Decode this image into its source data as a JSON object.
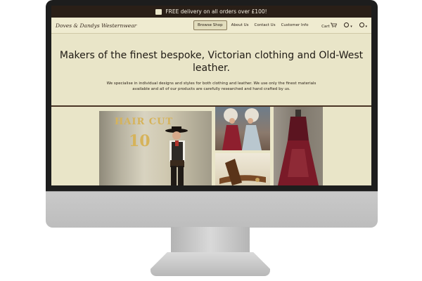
{
  "promo": {
    "text": "FREE delivery on all orders over £100!",
    "icon": "gift-icon"
  },
  "nav": {
    "logo": "Doves & Dandys Westernwear",
    "links": [
      "Browse Shop",
      "About Us",
      "Contact Us",
      "Customer Info"
    ],
    "cart_label": "Cart",
    "icons": [
      "cart-icon",
      "currency-icon",
      "account-icon"
    ]
  },
  "hero": {
    "title": "Makers of the finest bespoke, Victorian clothing and Old-West leather.",
    "body": "We specialise in individual designs and styles for both clothing and leather. We use only the finest materials available and all of our products are carefully researched and hand crafted by us."
  },
  "gallery": {
    "sign_top": "HAIR CUT",
    "sign_bottom": "10"
  },
  "colors": {
    "accent": "#2a1f17",
    "page_bg": "#e9e5c8"
  }
}
